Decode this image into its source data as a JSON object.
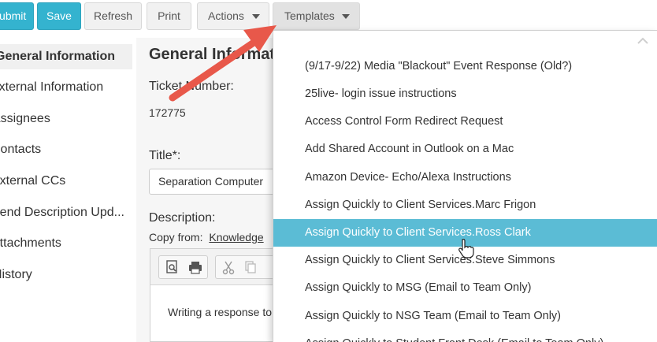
{
  "toolbar": {
    "submit_label": "Submit",
    "save_label": "Save",
    "refresh_label": "Refresh",
    "print_label": "Print",
    "actions_label": "Actions",
    "templates_label": "Templates"
  },
  "sidebar": {
    "items": [
      {
        "label": "General Information",
        "active": true
      },
      {
        "label": "External Information"
      },
      {
        "label": "Assignees"
      },
      {
        "label": "Contacts"
      },
      {
        "label": "External CCs"
      },
      {
        "label": "Send Description Upd..."
      },
      {
        "label": "Attachments"
      },
      {
        "label": "History"
      }
    ]
  },
  "main": {
    "heading": "General Information",
    "ticket_number_label": "Ticket Number:",
    "ticket_number_value": "172775",
    "title_label": "Title*:",
    "title_value": "Separation Computer",
    "description_label": "Description:",
    "copy_from_label": "Copy from:",
    "copy_from_link": "Knowledge",
    "editor_text": "Writing a response to"
  },
  "templates_dropdown": {
    "items": [
      "(9/17-9/22) Media \"Blackout\" Event Response (Old?)",
      "25live- login issue instructions",
      "Access Control Form Redirect Request",
      "Add Shared Account in Outlook on a Mac",
      "Amazon Device- Echo/Alexa Instructions",
      "Assign Quickly to Client Services.Marc Frigon",
      "Assign Quickly to Client Services.Ross Clark",
      "Assign Quickly to Client Services.Steve Simmons",
      "Assign Quickly to MSG (Email to Team Only)",
      "Assign Quickly to NSG Team (Email to Team Only)",
      "Assign Quickly to Student Front Desk (Email to Team Only)"
    ],
    "highlighted_index": 6
  },
  "colors": {
    "primary": "#34b3cf",
    "highlight": "#5bbcd5",
    "annotation_arrow": "#e8584a"
  }
}
